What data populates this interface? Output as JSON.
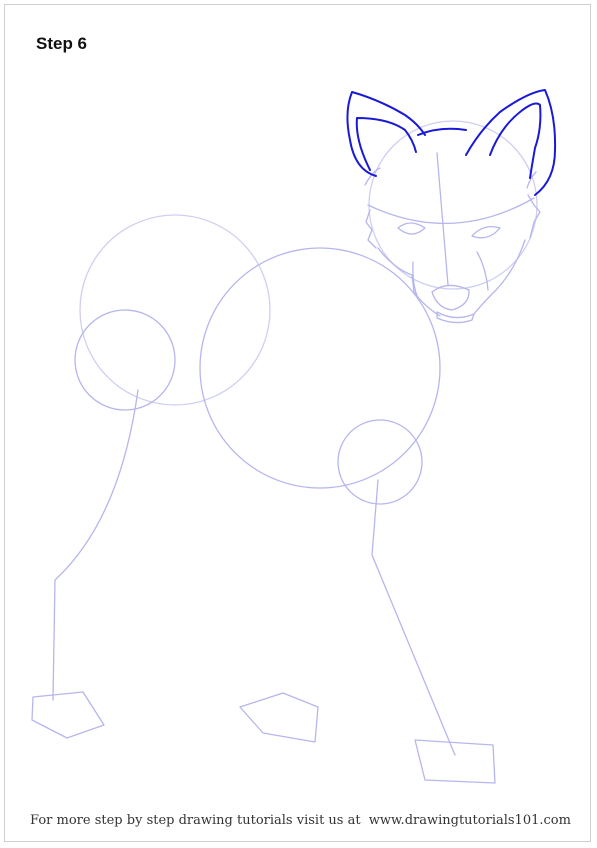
{
  "step_label": "Step 6",
  "footer": {
    "text": "For more step by step drawing tutorials visit us at",
    "site": "www.drawingtutorials101.com"
  },
  "colors": {
    "guide": "#b6b6ee",
    "guide_faint": "#d6d6f2",
    "new_line": "#1a1ad6",
    "border": "#cfcfcf"
  },
  "illustration": "dog-sketch"
}
